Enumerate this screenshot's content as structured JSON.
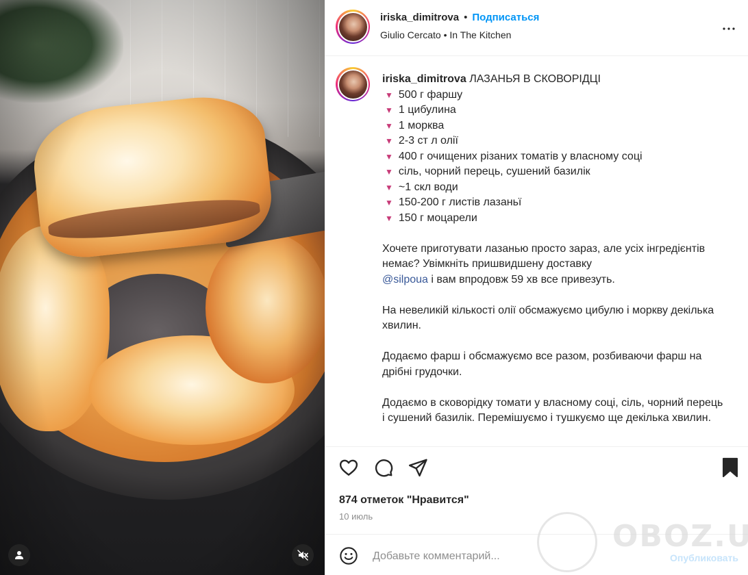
{
  "post": {
    "username": "iriska_dimitrova",
    "separator": "•",
    "follow_label": "Подписаться",
    "audio": "Giulio Cercato • In The Kitchen",
    "more_icon": "more-horizontal-icon"
  },
  "caption": {
    "username": "iriska_dimitrova",
    "title": "ЛАЗАНЬЯ В СКОВОРІДЦІ",
    "bullet_icon": "▼",
    "ingredients": [
      "500 г фаршу",
      "1 цибулина",
      "1 морква",
      "2-3 ст л олії",
      "400 г очищених різаних томатів у власному соці",
      "сіль, чорний перець, сушений базилік",
      "~1 скл води",
      "150-200 г листів лазаньї",
      "150 г моцарели"
    ],
    "para1_start": "Хочете приготувати лазанью просто зараз, але усіх інгредієнтів немає? Увімкніть пришвидшену доставку",
    "para1_mention": "@silpoua",
    "para1_end": "і вам впродовж 59 хв все привезуть.",
    "para2": "На невеликій кількості олії обсмажуємо цибулю і моркву декілька хвилин.",
    "para3": "Додаємо фарш і обсмажуємо все разом, розбиваючи фарш на дрібні грудочки.",
    "para4": "Додаємо в сковорідку томати у власному соці, сіль, чорний перець і сушений базилік. Перемішуємо і тушкуємо ще декілька хвилин."
  },
  "actions": {
    "likes": "874 отметок \"Нравится\"",
    "date": "10 июль"
  },
  "comment": {
    "placeholder": "Добавьте комментарий...",
    "publish_label": "Опубликовать"
  },
  "watermark": {
    "text": "OBOZ.UA"
  },
  "colors": {
    "accent": "#0095f6",
    "bullet": "#c73b78",
    "mention": "#385898"
  }
}
